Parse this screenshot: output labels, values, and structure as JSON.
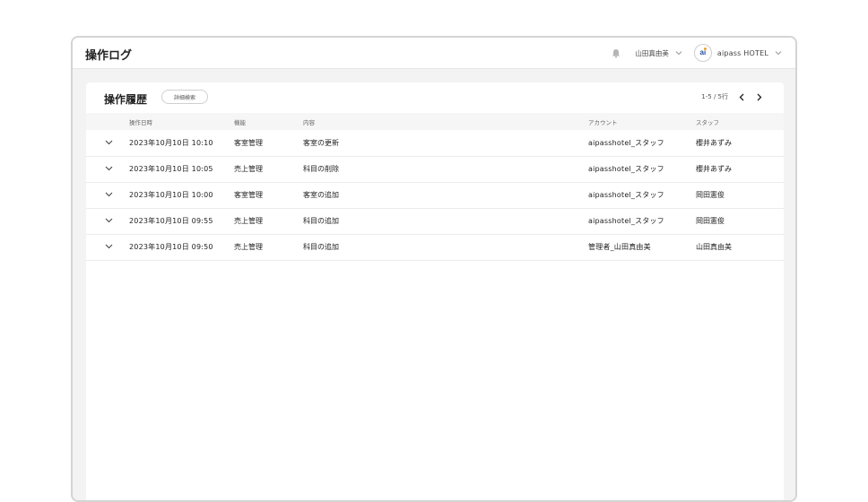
{
  "header": {
    "title": "操作ログ",
    "user_name": "山田真由美",
    "hotel_name": "aipass HOTEL",
    "logo_text": "ai"
  },
  "card": {
    "title": "操作履歴",
    "advanced_search_label": "詳細検索",
    "pagination": "1-5 / 5行"
  },
  "table": {
    "columns": {
      "date": "操作日時",
      "function": "機能",
      "content": "内容",
      "account": "アカウント",
      "staff": "スタッフ"
    },
    "rows": [
      {
        "date": "2023年10月10日 10:10",
        "function": "客室管理",
        "content": "客室の更新",
        "account": "aipasshotel_スタッフ",
        "staff": "櫻井あずみ"
      },
      {
        "date": "2023年10月10日 10:05",
        "function": "売上管理",
        "content": "科目の削除",
        "account": "aipasshotel_スタッフ",
        "staff": "櫻井あずみ"
      },
      {
        "date": "2023年10月10日 10:00",
        "function": "客室管理",
        "content": "客室の追加",
        "account": "aipasshotel_スタッフ",
        "staff": "岡田憲俊"
      },
      {
        "date": "2023年10月10日 09:55",
        "function": "売上管理",
        "content": "科目の追加",
        "account": "aipasshotel_スタッフ",
        "staff": "岡田憲俊"
      },
      {
        "date": "2023年10月10日 09:50",
        "function": "売上管理",
        "content": "科目の追加",
        "account": "管理者_山田真由美",
        "staff": "山田真由美"
      }
    ]
  },
  "icons": {
    "bell": "bell-icon",
    "user_dropdown": "chevron-down-icon",
    "hotel_dropdown": "chevron-down-icon",
    "prev_page": "chevron-left-icon",
    "next_page": "chevron-right-icon",
    "row_expand": "chevron-down-icon"
  },
  "colors": {
    "background": "#f3f3f3",
    "card": "#ffffff",
    "logo_blue": "#1f4ea8",
    "logo_dot": "#f0a020"
  }
}
